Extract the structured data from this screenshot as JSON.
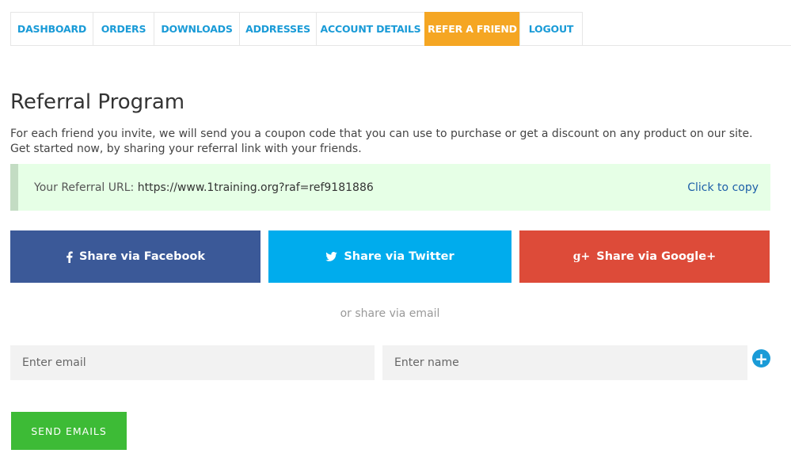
{
  "tabs": [
    {
      "label": "DASHBOARD"
    },
    {
      "label": "ORDERS"
    },
    {
      "label": "DOWNLOADS"
    },
    {
      "label": "ADDRESSES"
    },
    {
      "label": "ACCOUNT DETAILS"
    },
    {
      "label": "REFER A FRIEND",
      "active": true
    },
    {
      "label": "LOGOUT"
    }
  ],
  "page": {
    "title": "Referral Program",
    "intro": "For each friend you invite, we will send you a coupon code that you can use to purchase or get a discount on any product on our site. Get started now, by sharing your referral link with your friends."
  },
  "referral": {
    "label": "Your Referral URL:",
    "url": "https://www.1training.org?raf=ref9181886",
    "copy_label": "Click to copy"
  },
  "share": {
    "facebook_label": "Share via Facebook",
    "twitter_label": "Share via Twitter",
    "google_label": "Share via Google+",
    "or_email": "or share via email"
  },
  "form": {
    "email_placeholder": "Enter email",
    "name_placeholder": "Enter name",
    "send_label": "SEND EMAILS"
  },
  "icons": {
    "facebook": "facebook-icon",
    "twitter": "twitter-icon",
    "google": "google-plus-icon",
    "add": "plus-circle-icon"
  },
  "colors": {
    "tab_text": "#1a9bd7",
    "tab_active_bg": "#f5a623",
    "facebook": "#3b5998",
    "twitter": "#00aced",
    "google": "#dd4b39",
    "send": "#3dbb36",
    "referral_bg": "#e6ffe6"
  }
}
